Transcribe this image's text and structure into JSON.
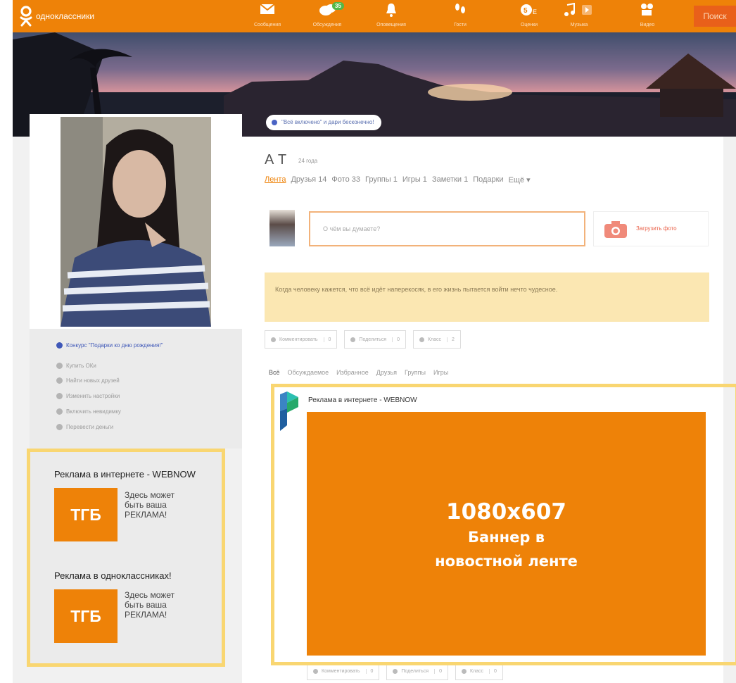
{
  "app": {
    "logo_text": "одноклассники",
    "search_label": "Поиск"
  },
  "nav": [
    {
      "label": "Сообщения",
      "icon": "envelope-icon"
    },
    {
      "label": "Обсуждения",
      "icon": "chat-bubbles-icon",
      "badge": "35"
    },
    {
      "label": "Оповещения",
      "icon": "bell-icon"
    },
    {
      "label": "Гости",
      "icon": "footprints-icon"
    },
    {
      "label": "Оценки",
      "icon": "ratings-icon"
    },
    {
      "label": "Музыка",
      "icon": "music-note-icon"
    },
    {
      "label": "Видео",
      "icon": "video-camera-icon"
    }
  ],
  "cover": {
    "pill_text": "\"Всё включено\" и дари бесконечно!"
  },
  "left_menu": [
    {
      "label": "Конкурс \"Подарки ко дню рождения!\"",
      "highlight": true
    },
    {
      "label": "Купить ОКи"
    },
    {
      "label": "Найти новых друзей"
    },
    {
      "label": "Изменить настройки"
    },
    {
      "label": "Включить невидимку"
    },
    {
      "label": "Перевести деньги"
    }
  ],
  "left_ads": [
    {
      "title": "Реклама в интернете - WEBNOW",
      "badge": "ТГБ",
      "desc_lines": [
        "Здесь может",
        "быть ваша",
        "РЕКЛАМА!"
      ]
    },
    {
      "title": "Реклама в одноклассниках!",
      "badge": "ТГБ",
      "desc_lines": [
        "Здесь может",
        "быть ваша",
        "РЕКЛАМА!"
      ]
    }
  ],
  "profile": {
    "name": "А Т",
    "age": "24 года",
    "tabs": [
      {
        "label": "Лента",
        "active": true
      },
      {
        "label": "Друзья 14"
      },
      {
        "label": "Фото 33"
      },
      {
        "label": "Группы 1"
      },
      {
        "label": "Игры 1"
      },
      {
        "label": "Заметки 1"
      },
      {
        "label": "Подарки"
      },
      {
        "label": "Ещё ▾"
      }
    ]
  },
  "composer": {
    "placeholder": "О чём вы думаете?",
    "upload_label": "Загрузить фото"
  },
  "status_note": "Когда человеку кажется, что всё идёт наперекосяк, в его жизнь пытается войти нечто чудесное.",
  "post_actions": [
    {
      "label": "Комментировать",
      "count": "0"
    },
    {
      "label": "Поделиться",
      "count": "0"
    },
    {
      "label": "Класс",
      "count": "2"
    }
  ],
  "feed_filters": [
    {
      "label": "Всё",
      "active": true
    },
    {
      "label": "Обсуждаемое"
    },
    {
      "label": "Избранное"
    },
    {
      "label": "Друзья"
    },
    {
      "label": "Группы"
    },
    {
      "label": "Игры"
    }
  ],
  "feed_ad": {
    "source": "Реклама в интернете - WEBNOW",
    "banner_size": "1080x607",
    "banner_line1": "Баннер в",
    "banner_line2": "новостной ленте"
  },
  "feed_ad_actions": [
    {
      "label": "Комментировать",
      "count": "0"
    },
    {
      "label": "Поделиться",
      "count": "0"
    },
    {
      "label": "Класс",
      "count": "0"
    }
  ],
  "colors": {
    "brand_orange": "#ee8208",
    "highlight_frame": "#f9d671",
    "note_bg": "#fbe7b2"
  }
}
